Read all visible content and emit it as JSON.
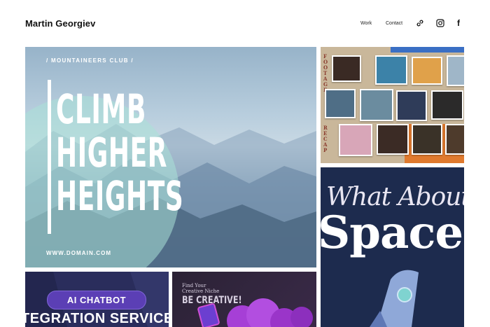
{
  "header": {
    "site_title": "Martin Georgiev",
    "nav": [
      {
        "label": "Work"
      },
      {
        "label": "Contact"
      }
    ],
    "icons": [
      "link-icon",
      "instagram-icon",
      "facebook-icon"
    ],
    "facebook_glyph": "f"
  },
  "gallery": {
    "mountain": {
      "club": "/ MOUNTAINEERS CLUB /",
      "headline": [
        "CLIMB",
        "HIGHER",
        "HEIGHTS"
      ],
      "domain": "WWW.DOMAIN.COM"
    },
    "recap": {
      "word_top": "F O O T A G E",
      "word_bottom": "R E C A P"
    },
    "space": {
      "script": "What About",
      "big": "Space"
    },
    "ai": {
      "pill": "AI CHATBOT",
      "line": "TEGRATION SERVICE"
    },
    "creative": {
      "small": "Find Your Creative Niche",
      "be": "BE CREATIVE!"
    }
  },
  "colors": {
    "space_bg": "#1d2b4e",
    "ai_bg": "#2a2d5c",
    "ai_pill": "#5b3fb5",
    "creative_bg": "#2b2235",
    "recap_orange": "#e07a2e"
  }
}
